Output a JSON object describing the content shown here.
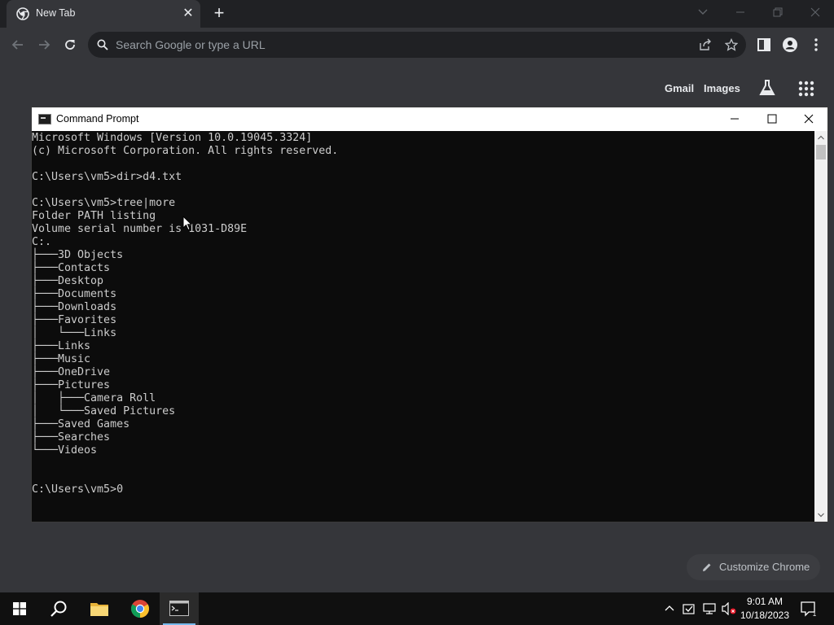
{
  "browser": {
    "tab_title": "New Tab",
    "omnibox_placeholder": "Search Google or type a URL",
    "ntp": {
      "gmail": "Gmail",
      "images": "Images",
      "customize": "Customize Chrome"
    }
  },
  "cmd": {
    "title": "Command Prompt",
    "lines": [
      "Microsoft Windows [Version 10.0.19045.3324]",
      "(c) Microsoft Corporation. All rights reserved.",
      "",
      "C:\\Users\\vm5>dir>d4.txt",
      "",
      "C:\\Users\\vm5>tree|more",
      "Folder PATH listing",
      "Volume serial number is 1031-D89E",
      "C:.",
      "├───3D Objects",
      "├───Contacts",
      "├───Desktop",
      "├───Documents",
      "├───Downloads",
      "├───Favorites",
      "│   └───Links",
      "├───Links",
      "├───Music",
      "├───OneDrive",
      "├───Pictures",
      "│   ├───Camera Roll",
      "│   └───Saved Pictures",
      "├───Saved Games",
      "├───Searches",
      "└───Videos",
      "",
      "",
      "C:\\Users\\vm5>0"
    ]
  },
  "taskbar": {
    "time": "9:01 AM",
    "date": "10/18/2023",
    "notification_count": "1"
  },
  "colors": {
    "chrome_frame": "#202124",
    "chrome_toolbar": "#35363a",
    "console_bg": "#0c0c0c",
    "console_text": "#cccccc",
    "taskbar_accent": "#76b9ed"
  }
}
